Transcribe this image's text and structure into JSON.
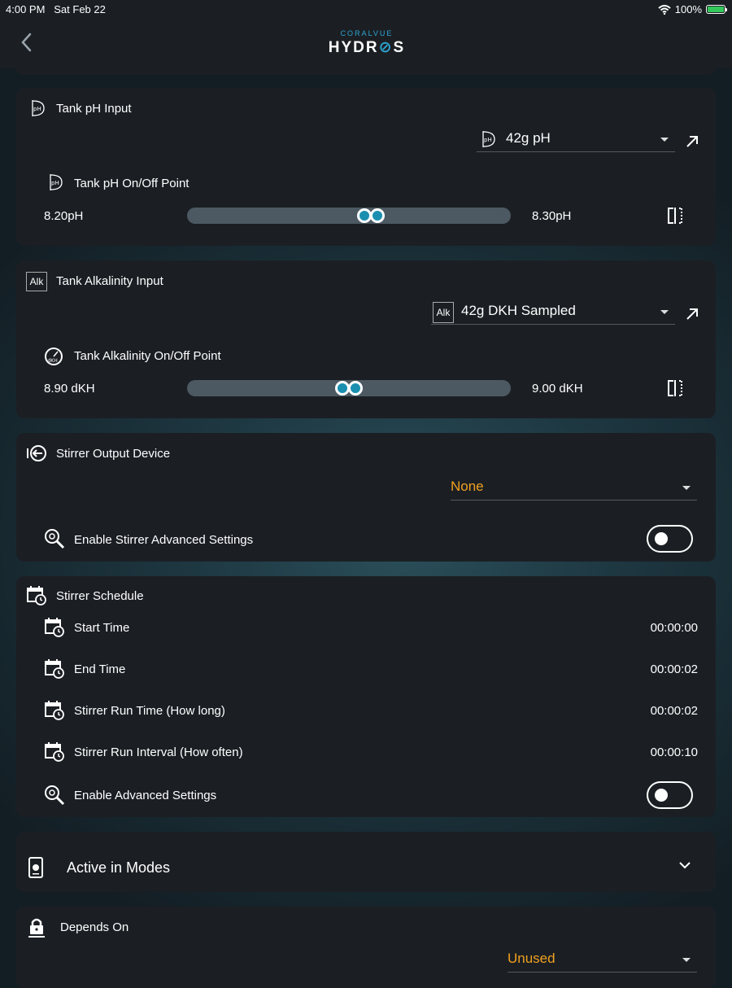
{
  "status_bar": {
    "time": "4:00 PM",
    "date": "Sat Feb 22",
    "battery": "100%",
    "battery_level": 1.0
  },
  "header": {
    "logo_top": "CORALVUE",
    "logo_main_a": "HYDR",
    "logo_main_b": "S"
  },
  "ph_card": {
    "title": "Tank pH Input",
    "icon_text": "pH",
    "selected_input": "42g pH",
    "onoff_label": "Tank pH On/Off Point",
    "min_label": "8.20pH",
    "max_label": "8.30pH",
    "range_low_fraction": 0.55,
    "range_high_fraction": 0.57
  },
  "alk_card": {
    "title": "Tank Alkalinity Input",
    "icon_text": "Alk",
    "selected_input": "42g DKH Sampled",
    "onoff_label": "Tank Alkalinity On/Off Point",
    "gauge_icon_text": "dKH",
    "min_label": "8.90 dKH",
    "max_label": "9.00 dKH",
    "range_low_fraction": 0.48,
    "range_high_fraction": 0.5
  },
  "stirrer_output": {
    "title": "Stirrer Output Device",
    "selected": "None",
    "advanced_label": "Enable Stirrer Advanced Settings",
    "advanced_enabled": false
  },
  "stirrer_schedule": {
    "title": "Stirrer Schedule",
    "rows": [
      {
        "label": "Start Time",
        "value": "00:00:00"
      },
      {
        "label": "End Time",
        "value": "00:00:02"
      },
      {
        "label": "Stirrer Run Time (How long)",
        "value": "00:00:02"
      },
      {
        "label": "Stirrer Run Interval (How often)",
        "value": "00:00:10"
      }
    ],
    "advanced_label": "Enable Advanced Settings",
    "advanced_enabled": false
  },
  "modes": {
    "title": "Active in Modes"
  },
  "depends": {
    "title": "Depends On",
    "selected": "Unused"
  },
  "colors": {
    "accent_orange": "#f0a020",
    "accent_blue": "#2ea6d2",
    "card_bg": "#1b1f24"
  },
  "icons": [
    "back-chevron-icon",
    "wifi-icon",
    "battery-icon",
    "ph-icon",
    "external-link-icon",
    "split-icon",
    "alk-icon",
    "dkh-gauge-icon",
    "output-device-icon",
    "gear-search-icon",
    "calendar-clock-icon",
    "mode-icon",
    "chevron-down-icon",
    "lock-icon"
  ]
}
